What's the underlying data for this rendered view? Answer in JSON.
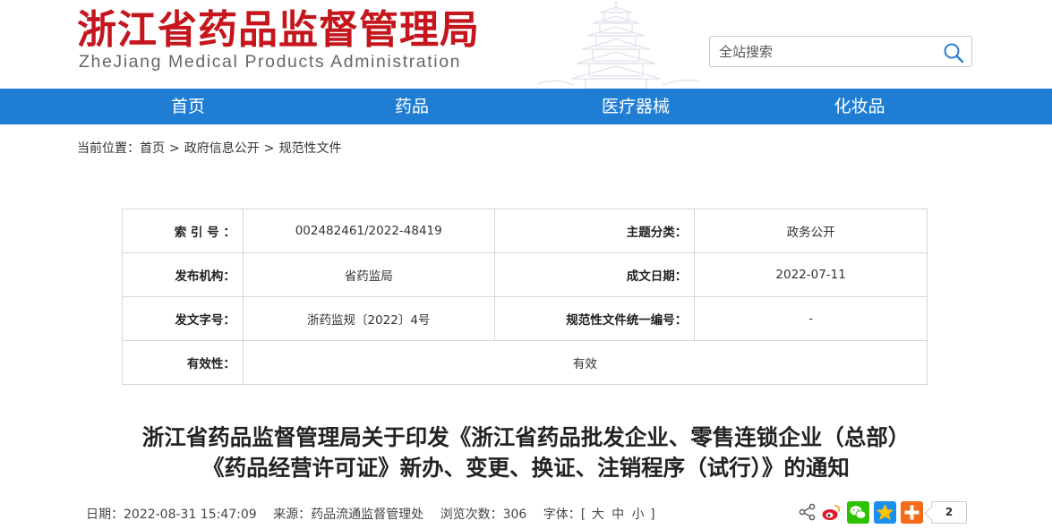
{
  "header": {
    "title_cn": "浙江省药品监督管理局",
    "title_en": "ZheJiang Medical Products Administration",
    "search_placeholder": "全站搜索"
  },
  "nav": {
    "items": [
      {
        "label": "首页"
      },
      {
        "label": "药品"
      },
      {
        "label": "医疗器械"
      },
      {
        "label": "化妆品"
      }
    ]
  },
  "breadcrumb": {
    "prefix": "当前位置：",
    "items": [
      "首页",
      "政府信息公开",
      "规范性文件"
    ],
    "separator": ">"
  },
  "info": {
    "index_label": "索 引 号 ：",
    "index_value": "002482461/2022-48419",
    "category_label": "主题分类：",
    "category_value": "政务公开",
    "issuer_label": "发布机构：",
    "issuer_value": "省药监局",
    "date_label": "成文日期：",
    "date_value": "2022-07-11",
    "docno_label": "发文字号：",
    "docno_value": "浙药监规〔2022〕4号",
    "unified_label": "规范性文件统一编号：",
    "unified_value": "-",
    "validity_label": "有效性：",
    "validity_value": "有效"
  },
  "article": {
    "title_line1": "浙江省药品监督管理局关于印发《浙江省药品批发企业、零售连锁企业（总部）",
    "title_line2": "《药品经营许可证》新办、变更、换证、注销程序（试行）》的通知"
  },
  "meta": {
    "date": "日期：2022-08-31 15:47:09",
    "source": "来源：药品流通监督管理处",
    "views": "浏览次数：306",
    "font_label": "字体：[",
    "font_large": "大",
    "font_medium": "中",
    "font_small": "小",
    "font_close": "]"
  },
  "share": {
    "count": "2"
  },
  "colors": {
    "brand_red": "#c4161c",
    "nav_blue": "#1f7ed4"
  }
}
